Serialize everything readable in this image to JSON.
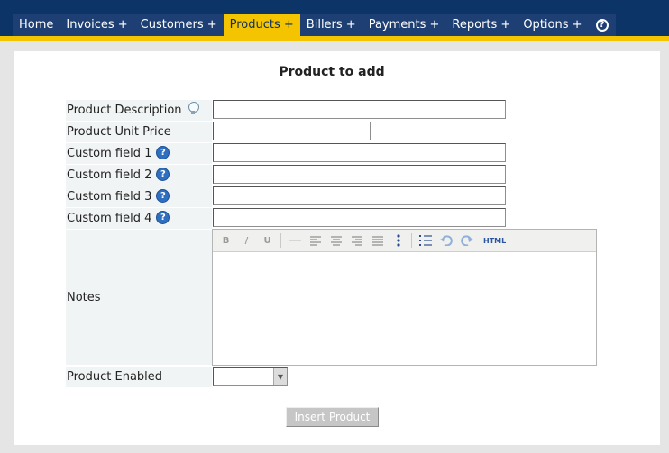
{
  "nav": {
    "items": [
      {
        "label": "Home"
      },
      {
        "label": "Invoices +"
      },
      {
        "label": "Customers +"
      },
      {
        "label": "Products +",
        "active": true
      },
      {
        "label": "Billers +"
      },
      {
        "label": "Payments +"
      },
      {
        "label": "Reports +"
      },
      {
        "label": "Options +"
      }
    ],
    "help_icon": "question-circle-icon"
  },
  "form": {
    "title": "Product to add",
    "fields": {
      "description": {
        "label": "Product Description",
        "value": "",
        "icon": "lightbulb-icon"
      },
      "unit_price": {
        "label": "Product Unit Price",
        "value": ""
      },
      "custom1": {
        "label": "Custom field 1",
        "value": "",
        "icon": "help-icon"
      },
      "custom2": {
        "label": "Custom field 2",
        "value": "",
        "icon": "help-icon"
      },
      "custom3": {
        "label": "Custom field 3",
        "value": "",
        "icon": "help-icon"
      },
      "custom4": {
        "label": "Custom field 4",
        "value": "",
        "icon": "help-icon"
      },
      "notes": {
        "label": "Notes",
        "value": ""
      },
      "enabled": {
        "label": "Product Enabled",
        "selected": ""
      }
    },
    "editor_toolbar": {
      "html_label": "HTML"
    },
    "submit_label": "Insert Product"
  },
  "colors": {
    "header_bg": "#0c3466",
    "accent": "#f5c400",
    "label_bg": "#f1f4f4"
  }
}
